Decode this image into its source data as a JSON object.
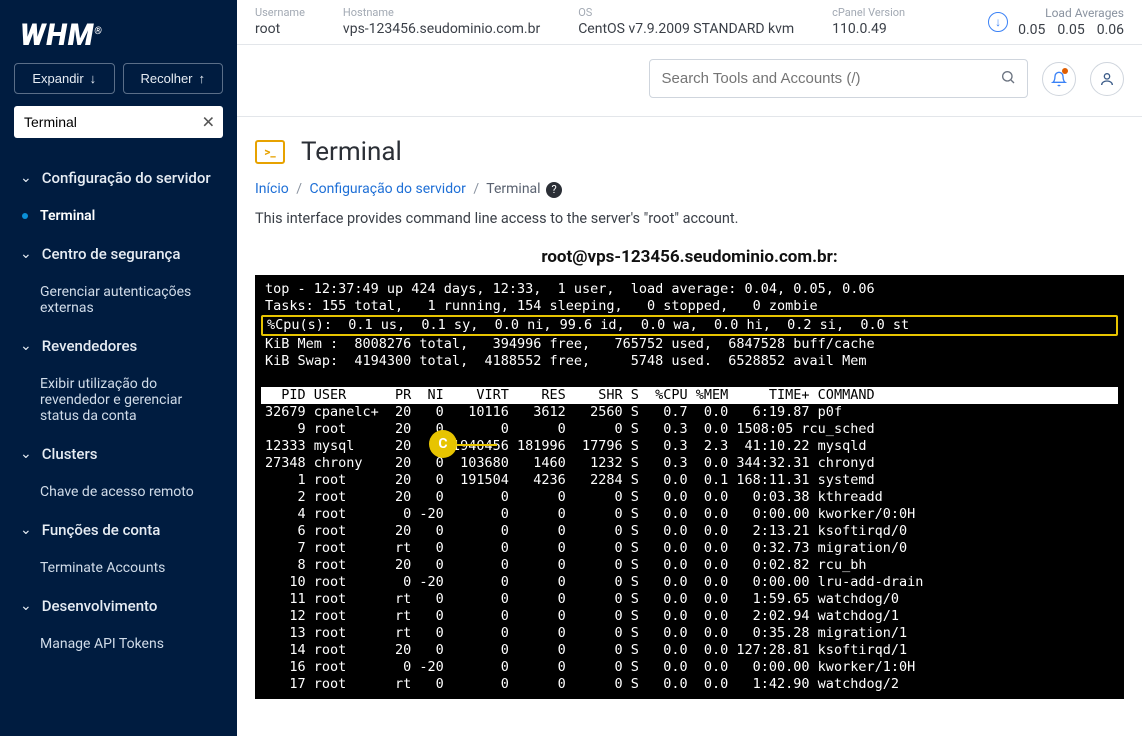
{
  "sidebar": {
    "logo": "WHM",
    "expand": "Expandir",
    "collapse": "Recolher",
    "search_value": "Terminal",
    "groups": [
      {
        "label": "Configuração do servidor",
        "items": [
          {
            "label": "Terminal",
            "active": true
          }
        ]
      },
      {
        "label": "Centro de segurança",
        "items": [
          {
            "label": "Gerenciar autenticações externas"
          }
        ]
      },
      {
        "label": "Revendedores",
        "items": [
          {
            "label": "Exibir utilização do revendedor e gerenciar status da conta"
          }
        ]
      },
      {
        "label": "Clusters",
        "items": [
          {
            "label": "Chave de acesso remoto"
          }
        ]
      },
      {
        "label": "Funções de conta",
        "items": [
          {
            "label": "Terminate Accounts"
          }
        ]
      },
      {
        "label": "Desenvolvimento",
        "items": [
          {
            "label": "Manage API Tokens"
          }
        ]
      }
    ]
  },
  "topbar": {
    "cols": [
      {
        "lbl": "Username",
        "val": "root"
      },
      {
        "lbl": "Hostname",
        "val": "vps-123456.seudominio.com.br"
      },
      {
        "lbl": "OS",
        "val": "CentOS v7.9.2009 STANDARD kvm"
      },
      {
        "lbl": "cPanel Version",
        "val": "110.0.49"
      }
    ],
    "load_lbl": "Load Averages",
    "loads": [
      "0.05",
      "0.05",
      "0.06"
    ]
  },
  "search_placeholder": "Search Tools and Accounts (/)",
  "page": {
    "title": "Terminal",
    "crumb_home": "Início",
    "crumb_group": "Configuração do servidor",
    "crumb_page": "Terminal",
    "description": "This interface provides command line access to the server's \"root\" account.",
    "term_title": "root@vps-123456.seudominio.com.br:"
  },
  "callout": "C",
  "term": {
    "l1": "top - 12:37:49 up 424 days, 12:33,  1 user,  load average: 0.04, 0.05, 0.06",
    "l2": "Tasks: 155 total,   1 running, 154 sleeping,   0 stopped,   0 zombie",
    "l3": "%Cpu(s):  0.1 us,  0.1 sy,  0.0 ni, 99.6 id,  0.0 wa,  0.0 hi,  0.2 si,  0.0 st",
    "l4": "KiB Mem :  8008276 total,   394996 free,   765752 used,  6847528 buff/cache",
    "l5": "KiB Swap:  4194300 total,  4188552 free,     5748 used.  6528852 avail Mem",
    "hdr": "  PID USER      PR  NI    VIRT    RES    SHR S  %CPU %MEM     TIME+ COMMAND       ",
    "rows": [
      "32679 cpanelc+  20   0   10116   3612   2560 S   0.7  0.0   6:19.87 p0f",
      "    9 root      20   0       0      0      0 S   0.3  0.0 1508:05 rcu_sched",
      "12333 mysql     20   0 1940456 181996  17796 S   0.3  2.3  41:10.22 mysqld",
      "27348 chrony    20   0  103680   1460   1232 S   0.3  0.0 344:32.31 chronyd",
      "    1 root      20   0  191504   4236   2284 S   0.0  0.1 168:11.31 systemd",
      "    2 root      20   0       0      0      0 S   0.0  0.0   0:03.38 kthreadd",
      "    4 root       0 -20       0      0      0 S   0.0  0.0   0:00.00 kworker/0:0H",
      "    6 root      20   0       0      0      0 S   0.0  0.0   2:13.21 ksoftirqd/0",
      "    7 root      rt   0       0      0      0 S   0.0  0.0   0:32.73 migration/0",
      "    8 root      20   0       0      0      0 S   0.0  0.0   0:02.82 rcu_bh",
      "   10 root       0 -20       0      0      0 S   0.0  0.0   0:00.00 lru-add-drain",
      "   11 root      rt   0       0      0      0 S   0.0  0.0   1:59.65 watchdog/0",
      "   12 root      rt   0       0      0      0 S   0.0  0.0   2:02.94 watchdog/1",
      "   13 root      rt   0       0      0      0 S   0.0  0.0   0:35.28 migration/1",
      "   14 root      20   0       0      0      0 S   0.0  0.0 127:28.81 ksoftirqd/1",
      "   16 root       0 -20       0      0      0 S   0.0  0.0   0:00.00 kworker/1:0H",
      "   17 root      rt   0       0      0      0 S   0.0  0.0   1:42.90 watchdog/2"
    ]
  }
}
